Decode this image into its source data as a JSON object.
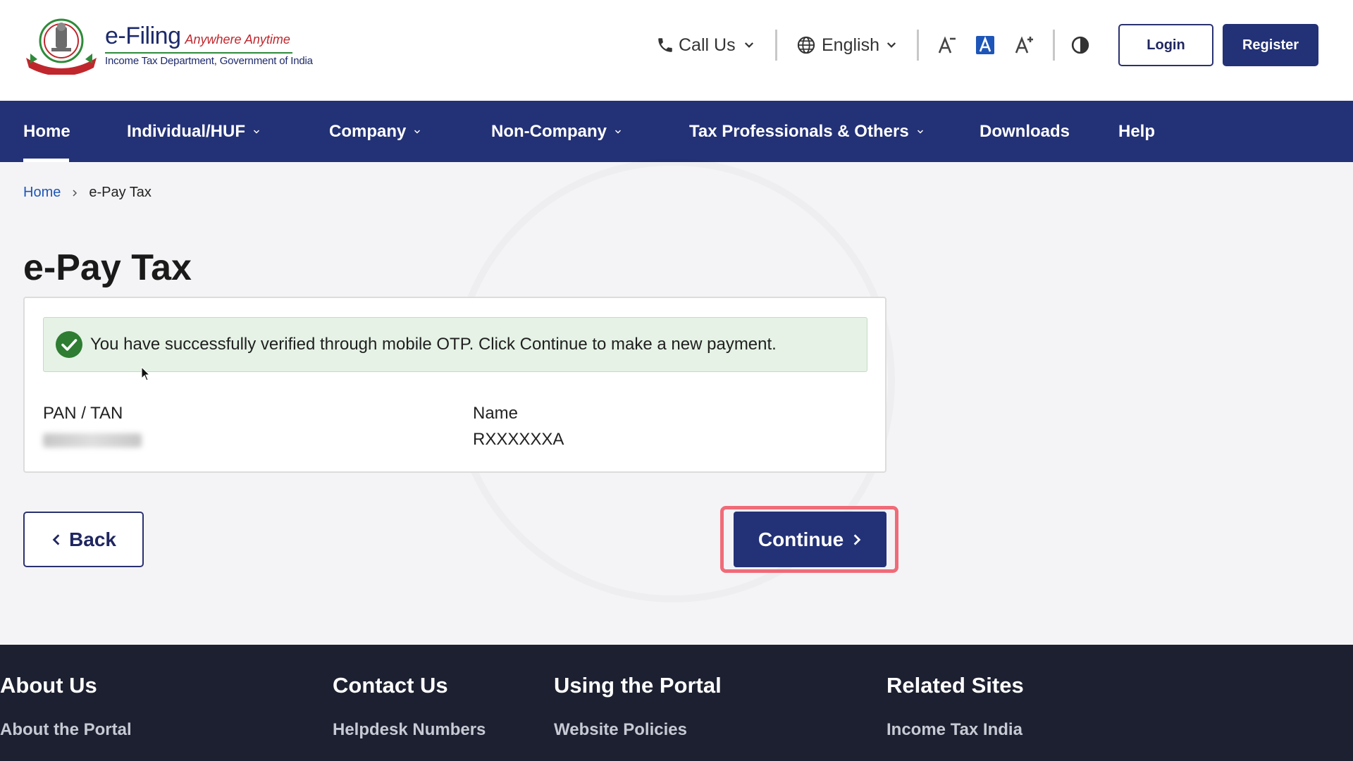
{
  "header": {
    "brand_name": "e-Filing",
    "brand_tagline": "Anywhere Anytime",
    "brand_subtitle": "Income Tax Department, Government of India",
    "call_us": "Call Us",
    "language": "English",
    "login_label": "Login",
    "register_label": "Register"
  },
  "nav": {
    "items": [
      {
        "label": "Home",
        "active": true
      },
      {
        "label": "Individual/HUF"
      },
      {
        "label": "Company"
      },
      {
        "label": "Non-Company"
      },
      {
        "label": "Tax Professionals & Others"
      },
      {
        "label": "Downloads"
      },
      {
        "label": "Help"
      }
    ]
  },
  "breadcrumb": {
    "home": "Home",
    "current": "e-Pay Tax"
  },
  "page": {
    "title": "e-Pay Tax",
    "success_message": "You have successfully verified through mobile OTP. Click Continue to make a new payment.",
    "pan_label": "PAN / TAN",
    "name_label": "Name",
    "name_value": "RXXXXXXA",
    "back_label": "Back",
    "continue_label": "Continue"
  },
  "footer": {
    "columns": [
      {
        "heading": "About Us",
        "links": [
          "About the Portal"
        ]
      },
      {
        "heading": "Contact Us",
        "links": [
          "Helpdesk Numbers"
        ]
      },
      {
        "heading": "Using the Portal",
        "links": [
          "Website Policies"
        ]
      },
      {
        "heading": "Related Sites",
        "links": [
          "Income Tax India"
        ]
      }
    ]
  },
  "colors": {
    "primary_navy": "#233176",
    "success_green": "#2e7d32",
    "highlight_pink": "#f06b78",
    "footer_bg": "#1c2030"
  },
  "icons": {
    "call": "phone-icon",
    "language": "globe-icon",
    "font_decrease": "font-decrease-icon",
    "font_default": "font-default-icon",
    "font_increase": "font-increase-icon",
    "contrast": "contrast-icon",
    "success": "check-circle-icon"
  }
}
